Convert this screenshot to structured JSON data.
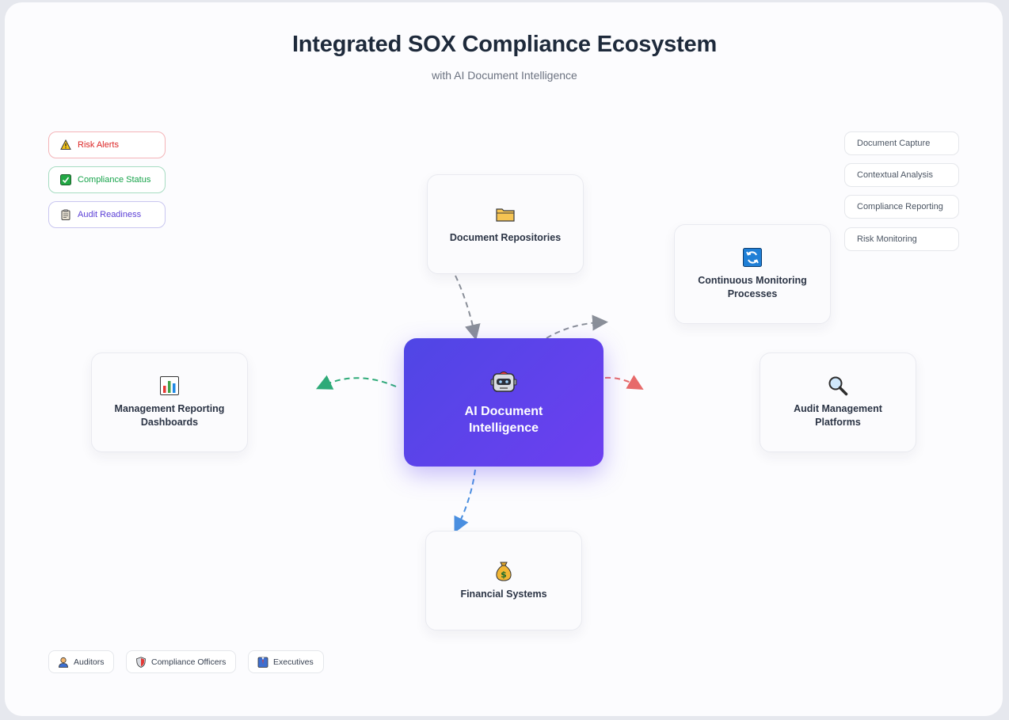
{
  "header": {
    "title": "Integrated SOX Compliance Ecosystem",
    "subtitle": "with AI Document Intelligence"
  },
  "status_legend": [
    {
      "label": "Risk Alerts",
      "icon": "warning-icon",
      "color": "#dc2626",
      "border": "#f4b4b8"
    },
    {
      "label": "Compliance Status",
      "icon": "checkmark-icon",
      "color": "#16a34a",
      "border": "#a7dcc2"
    },
    {
      "label": "Audit Readiness",
      "icon": "clipboard-icon",
      "color": "#5b3fd6",
      "border": "#c9c6f0"
    }
  ],
  "processes": [
    {
      "label": "Document Capture"
    },
    {
      "label": "Contextual Analysis"
    },
    {
      "label": "Compliance Reporting"
    },
    {
      "label": "Risk Monitoring"
    }
  ],
  "hub": {
    "label": "AI Document Intelligence",
    "icon": "robot-icon"
  },
  "nodes": {
    "repositories": {
      "label": "Document Repositories",
      "icon": "folder-icon"
    },
    "monitoring": {
      "label": "Continuous Monitoring Processes",
      "icon": "refresh-icon"
    },
    "dashboards": {
      "label": "Management Reporting Dashboards",
      "icon": "bar-chart-icon"
    },
    "audit": {
      "label": "Audit Management Platforms",
      "icon": "magnifier-icon"
    },
    "financial": {
      "label": "Financial Systems",
      "icon": "money-bag-icon"
    }
  },
  "users": [
    {
      "label": "Auditors",
      "icon": "person-icon"
    },
    {
      "label": "Compliance Officers",
      "icon": "shield-icon"
    },
    {
      "label": "Executives",
      "icon": "briefcase-icon"
    }
  ],
  "colors": {
    "hub_gradient_start": "#4f46e5",
    "hub_gradient_end": "#6d3ff0",
    "arrow_gray": "#8a8f99",
    "arrow_green": "#2eaa78",
    "arrow_red": "#e76a6a",
    "arrow_blue": "#4a8fe0"
  }
}
